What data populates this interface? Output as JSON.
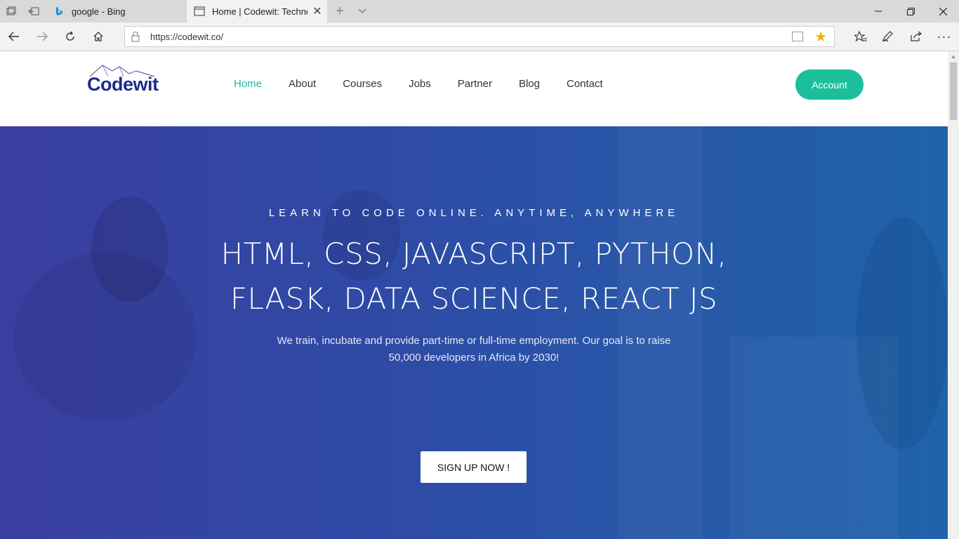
{
  "browser": {
    "tabs": [
      {
        "title": "google - Bing",
        "favicon": "bing-icon",
        "active": false
      },
      {
        "title": "Home | Codewit: Techno",
        "favicon": "page-icon",
        "active": true
      }
    ],
    "url": "https://codewit.co/",
    "icons": {
      "tab_preview": "tab-preview-icon",
      "set_aside": "set-aside-tabs-icon",
      "new_tab": "plus-icon",
      "tab_list": "chevron-down-icon",
      "minimize": "minimize-icon",
      "restore": "restore-icon",
      "close": "close-icon",
      "back": "back-arrow-icon",
      "forward": "forward-arrow-icon",
      "refresh": "refresh-icon",
      "home": "home-icon",
      "lock": "lock-icon",
      "reading_view": "reading-view-icon",
      "favorite": "star-icon",
      "favorites_hub": "favorites-list-icon",
      "notes": "pen-icon",
      "share": "share-icon",
      "more": "more-icon"
    },
    "favorite_color": "#f0b400"
  },
  "site": {
    "logo_text": "Codewit",
    "nav": [
      {
        "label": "Home",
        "active": true
      },
      {
        "label": "About",
        "active": false
      },
      {
        "label": "Courses",
        "active": false
      },
      {
        "label": "Jobs",
        "active": false
      },
      {
        "label": "Partner",
        "active": false
      },
      {
        "label": "Blog",
        "active": false
      },
      {
        "label": "Contact",
        "active": false
      }
    ],
    "account_label": "Account",
    "accent_color": "#1cbf9b",
    "brand_color": "#1f2a8c"
  },
  "hero": {
    "eyebrow": "LEARN TO CODE ONLINE. ANYTIME, ANYWHERE",
    "headline_line1": "HTML, CSS, JAVASCRIPT, PYTHON,",
    "headline_line2": "FLASK, DATA SCIENCE, REACT JS",
    "subtext": "We train, incubate and provide part-time or full-time employment. Our goal is to raise 50,000 developers in Africa by 2030!",
    "cta_label": "SIGN UP NOW !"
  }
}
